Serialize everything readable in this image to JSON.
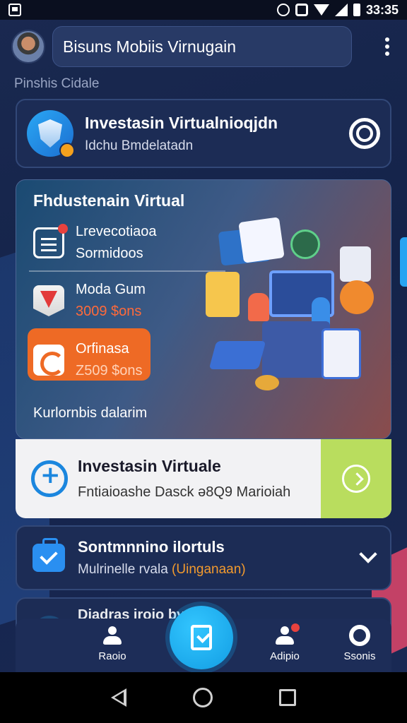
{
  "status_bar": {
    "time": "33:35"
  },
  "header": {
    "title": "Bisuns Mobiis Virnugain"
  },
  "section_label": "Pinshis Cidale",
  "card_investment": {
    "title": "Investasin Virtualnioqjdn",
    "subtitle": "Idchu Bmdelatadn"
  },
  "promo": {
    "title": "Fhdustenain Virtual",
    "items": [
      {
        "line1": "Lrevecotiaoa",
        "line2": "Sormidoos",
        "line2_color": "#ffffff"
      },
      {
        "line1": "Moda Gum",
        "line2": "3009 $ons",
        "line2_color": "#ff6a3a"
      },
      {
        "line1": "Orfinasa",
        "line2": "Z509 $ons",
        "line2_color": "#ffd2b8"
      }
    ],
    "footer": "Kurlornbis dalarim"
  },
  "card_virtuale": {
    "title": "Investasin Virtuale",
    "subtitle": "Fntiaioashe Dasck ə8Q9 Marioiah"
  },
  "card_settings": {
    "title": "Sontmnnino ilortuls",
    "subtitle_prefix": "Mulrinelle rvala ",
    "subtitle_highlight": "(Uinganaan)"
  },
  "card_partial": {
    "title": "Diadras iroio by..."
  },
  "bottom_nav": {
    "items": [
      {
        "label": "Raoio"
      },
      {
        "label": "Adipio"
      },
      {
        "label": "Ssonis"
      }
    ]
  },
  "colors": {
    "accent_blue": "#27a4f2",
    "accent_orange": "#ee6a25",
    "accent_green": "#b9dd5e",
    "background": "#1a2950"
  },
  "icons": {
    "promo_item_0": "document-icon",
    "promo_item_1": "shield-icon",
    "promo_item_2": "refresh-icon",
    "fab": "edit-check-icon"
  }
}
